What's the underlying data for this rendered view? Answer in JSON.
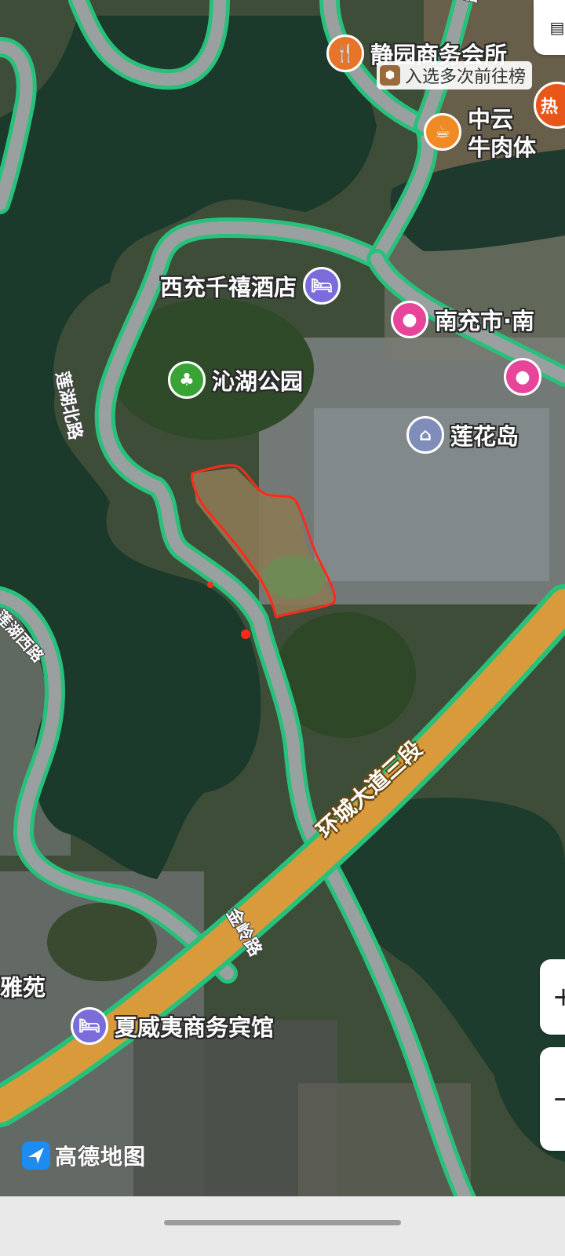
{
  "map": {
    "pois": [
      {
        "label": "静园商务会所",
        "icon": "restaurant-icon",
        "color": "#e8742a"
      },
      {
        "label": "中云",
        "label2": "牛肉体",
        "icon": "food-icon",
        "color": "#f08a24"
      },
      {
        "label": "西充千禧酒店",
        "icon": "hotel-icon",
        "color": "#7b6cdc"
      },
      {
        "label": "南充市·南",
        "icon": "shopping-icon",
        "color": "#e6459a"
      },
      {
        "label": "沁湖公园",
        "icon": "park-icon",
        "color": "#3aa335"
      },
      {
        "label": "莲花岛",
        "icon": "landmark-icon",
        "color": "#7f8db8"
      },
      {
        "label": "夏威夷商务宾馆",
        "icon": "hotel-icon",
        "color": "#7b6cdc"
      },
      {
        "label": "雅苑",
        "icon": "",
        "color": ""
      },
      {
        "label": "",
        "icon": "shopping-icon",
        "color": "#e6459a"
      }
    ],
    "ranking_badge": "入选多次前往榜",
    "roads": {
      "lianhu_north": "莲湖北路",
      "ring_road": "环城大道三段",
      "jinling": "金岭路",
      "left_road": "莲湖西路",
      "top_road": "路"
    },
    "hotspot_badge": "热",
    "logo": "高德地图",
    "colors": {
      "water": "#1c3a2c",
      "road_casing": "#27c17b",
      "ring_road": "#d99a3c",
      "annotation": "#ff2a1a"
    }
  }
}
